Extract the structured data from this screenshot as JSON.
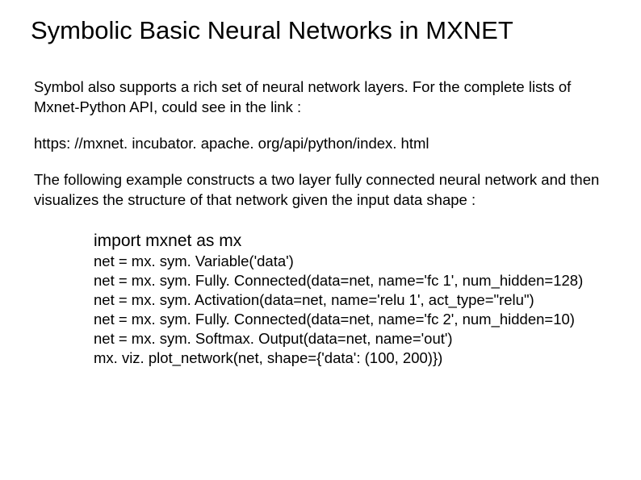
{
  "title": "Symbolic Basic Neural Networks in MXNET",
  "paragraph1": "Symbol also supports a rich set of neural network layers. For the complete lists of Mxnet-Python API, could see in the link :",
  "link": "https: //mxnet. incubator. apache. org/api/python/index. html",
  "paragraph2": "The following example constructs a two layer fully connected neural network and then visualizes the structure of that network given the input data shape :",
  "code": {
    "import_line": "import mxnet as mx",
    "line1": "net = mx. sym. Variable('data')",
    "line2": "net = mx. sym. Fully. Connected(data=net, name='fc 1', num_hidden=128)",
    "line3": "net = mx. sym. Activation(data=net, name='relu 1', act_type=\"relu\")",
    "line4": "net = mx. sym. Fully. Connected(data=net, name='fc 2', num_hidden=10)",
    "line5": "net = mx. sym. Softmax. Output(data=net, name='out')",
    "line6": "mx. viz. plot_network(net, shape={'data': (100, 200)})"
  }
}
